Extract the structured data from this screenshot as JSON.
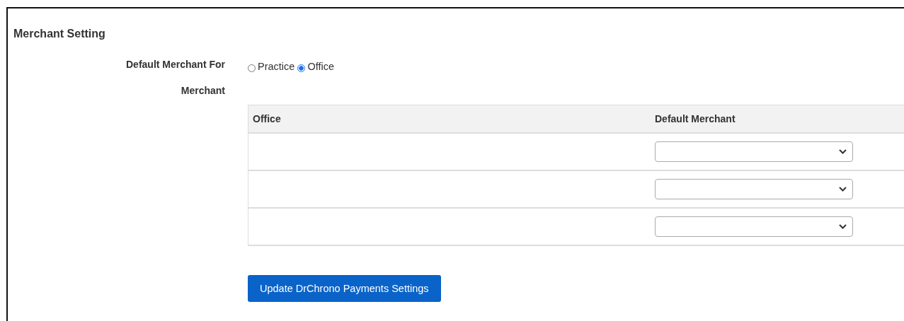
{
  "title": "Merchant Setting",
  "default_for": {
    "label": "Default Merchant For",
    "options": [
      {
        "label": "Practice",
        "selected": false
      },
      {
        "label": "Office",
        "selected": true
      }
    ]
  },
  "merchant": {
    "label": "Merchant",
    "columns": [
      "Office",
      "Default Merchant"
    ],
    "rows": [
      {
        "office": ""
      },
      {
        "office": ""
      },
      {
        "office": ""
      }
    ]
  },
  "button": "Update DrChrono Payments Settings"
}
